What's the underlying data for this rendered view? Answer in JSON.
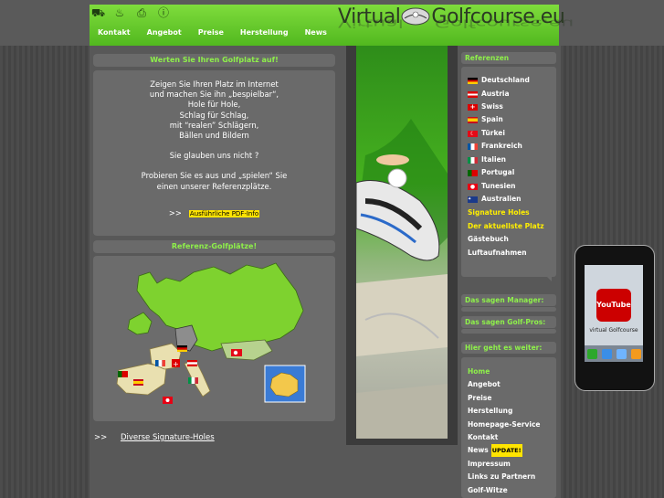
{
  "nav": {
    "icons": [
      "car-icon",
      "cake-icon",
      "print-icon",
      "info-icon"
    ],
    "links": [
      "Kontakt",
      "Angebot",
      "Preise",
      "Herstellung",
      "News"
    ]
  },
  "logo": {
    "text_left": "Virtual",
    "text_right": "Golfcourse.eu"
  },
  "rate_panel": {
    "title": "Werten Sie Ihren Golfplatz auf!"
  },
  "intro": {
    "p1": [
      "Zeigen Sie Ihren Platz im Internet",
      "und machen Sie ihn „bespielbar“,",
      "Hole für Hole,",
      "Schlag für Schlag,",
      "mit “realen” Schlägern,",
      "Bällen und Bildern"
    ],
    "p2": "Sie glauben uns nicht ?",
    "p3": [
      "Probieren Sie es aus und „spielen“ Sie",
      "einen unserer Referenzplätze."
    ],
    "pdf_prefix": ">>",
    "pdf_label": "Ausführliche PDF-Info"
  },
  "map_panel": {
    "title": "Referenz-Golfplätze!"
  },
  "signature_link": {
    "prefix": ">>",
    "label": "Diverse Signature-Holes"
  },
  "references": {
    "title": "Referenzen",
    "items": [
      {
        "label": "Deutschland",
        "flag": "de"
      },
      {
        "label": "Austria",
        "flag": "at"
      },
      {
        "label": "Swiss",
        "flag": "ch"
      },
      {
        "label": "Spain",
        "flag": "es"
      },
      {
        "label": "Türkei",
        "flag": "tr"
      },
      {
        "label": "Frankreich",
        "flag": "fr"
      },
      {
        "label": "Italien",
        "flag": "it"
      },
      {
        "label": "Portugal",
        "flag": "pt"
      },
      {
        "label": "Tunesien",
        "flag": "tn"
      },
      {
        "label": "Australien",
        "flag": "au"
      }
    ],
    "links": [
      {
        "label": "Signature Holes",
        "color": "yellow"
      },
      {
        "label": "Der aktuellste Platz",
        "color": "yellow"
      },
      {
        "label": "Gästebuch",
        "color": "white"
      },
      {
        "label": "Luftaufnahmen",
        "color": "white"
      }
    ]
  },
  "managers": {
    "title": "Das sagen Manager:"
  },
  "golfpros": {
    "title": "Das sagen Golf-Pros:"
  },
  "more": {
    "title": "Hier geht es weiter:",
    "items": [
      {
        "label": "Home",
        "highlight": true
      },
      {
        "label": "Angebot"
      },
      {
        "label": "Preise"
      },
      {
        "label": "Herstellung"
      },
      {
        "label": "Homepage-Service"
      },
      {
        "label": "Kontakt"
      },
      {
        "label": "News",
        "badge": "UPDATE!"
      },
      {
        "label": "Impressum"
      },
      {
        "label": "Links zu Partnern"
      },
      {
        "label": "Golf-Witze"
      }
    ]
  },
  "phone": {
    "app_label": "virtual Golfcourse",
    "youtube": "YouTube"
  },
  "colors": {
    "accent": "#8ef04a",
    "yellow": "#ffee00",
    "bg": "#4a4a4a"
  }
}
